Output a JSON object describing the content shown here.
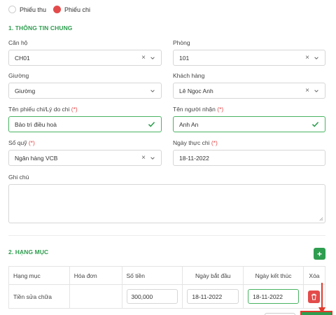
{
  "voucher_type": {
    "receipt_label": "Phiếu thu",
    "payment_label": "Phiếu chi",
    "selected": "payment"
  },
  "general": {
    "title": "1. THÔNG TIN CHUNG",
    "apartment": {
      "label": "Căn hộ",
      "value": "CH01"
    },
    "room": {
      "label": "Phòng",
      "value": "101"
    },
    "bed": {
      "label": "Giường",
      "value": "Giường"
    },
    "customer": {
      "label": "Khách hàng",
      "value": "Lê Ngọc Anh"
    },
    "voucher_name": {
      "label": "Tên phiếu chi/Lý do chi",
      "required_mark": "(*)",
      "value": "Bảo trì điều hoà"
    },
    "recipient": {
      "label": "Tên người nhận",
      "required_mark": "(*)",
      "value": "Anh An"
    },
    "fund": {
      "label": "Sổ quỹ",
      "required_mark": "(*)",
      "value": "Ngân hàng VCB"
    },
    "pay_date": {
      "label": "Ngày thực chi",
      "required_mark": "(*)",
      "value": "18-11-2022"
    },
    "note": {
      "label": "Ghi chú",
      "value": ""
    }
  },
  "items": {
    "title": "2. HẠNG MỤC",
    "add_label": "+",
    "columns": [
      "Hạng mục",
      "Hóa đơn",
      "Số tiền",
      "Ngày bắt đầu",
      "Ngày kết thúc",
      "Xóa"
    ],
    "rows": [
      {
        "name": "Tiền sửa chữa",
        "invoice": "",
        "amount": "300,000",
        "start": "18-11-2022",
        "end": "18-11-2022"
      }
    ]
  },
  "colors": {
    "accent_green": "#2e9d4f",
    "danger_red": "#e34b4b",
    "annotation_red": "#e03a2b"
  }
}
